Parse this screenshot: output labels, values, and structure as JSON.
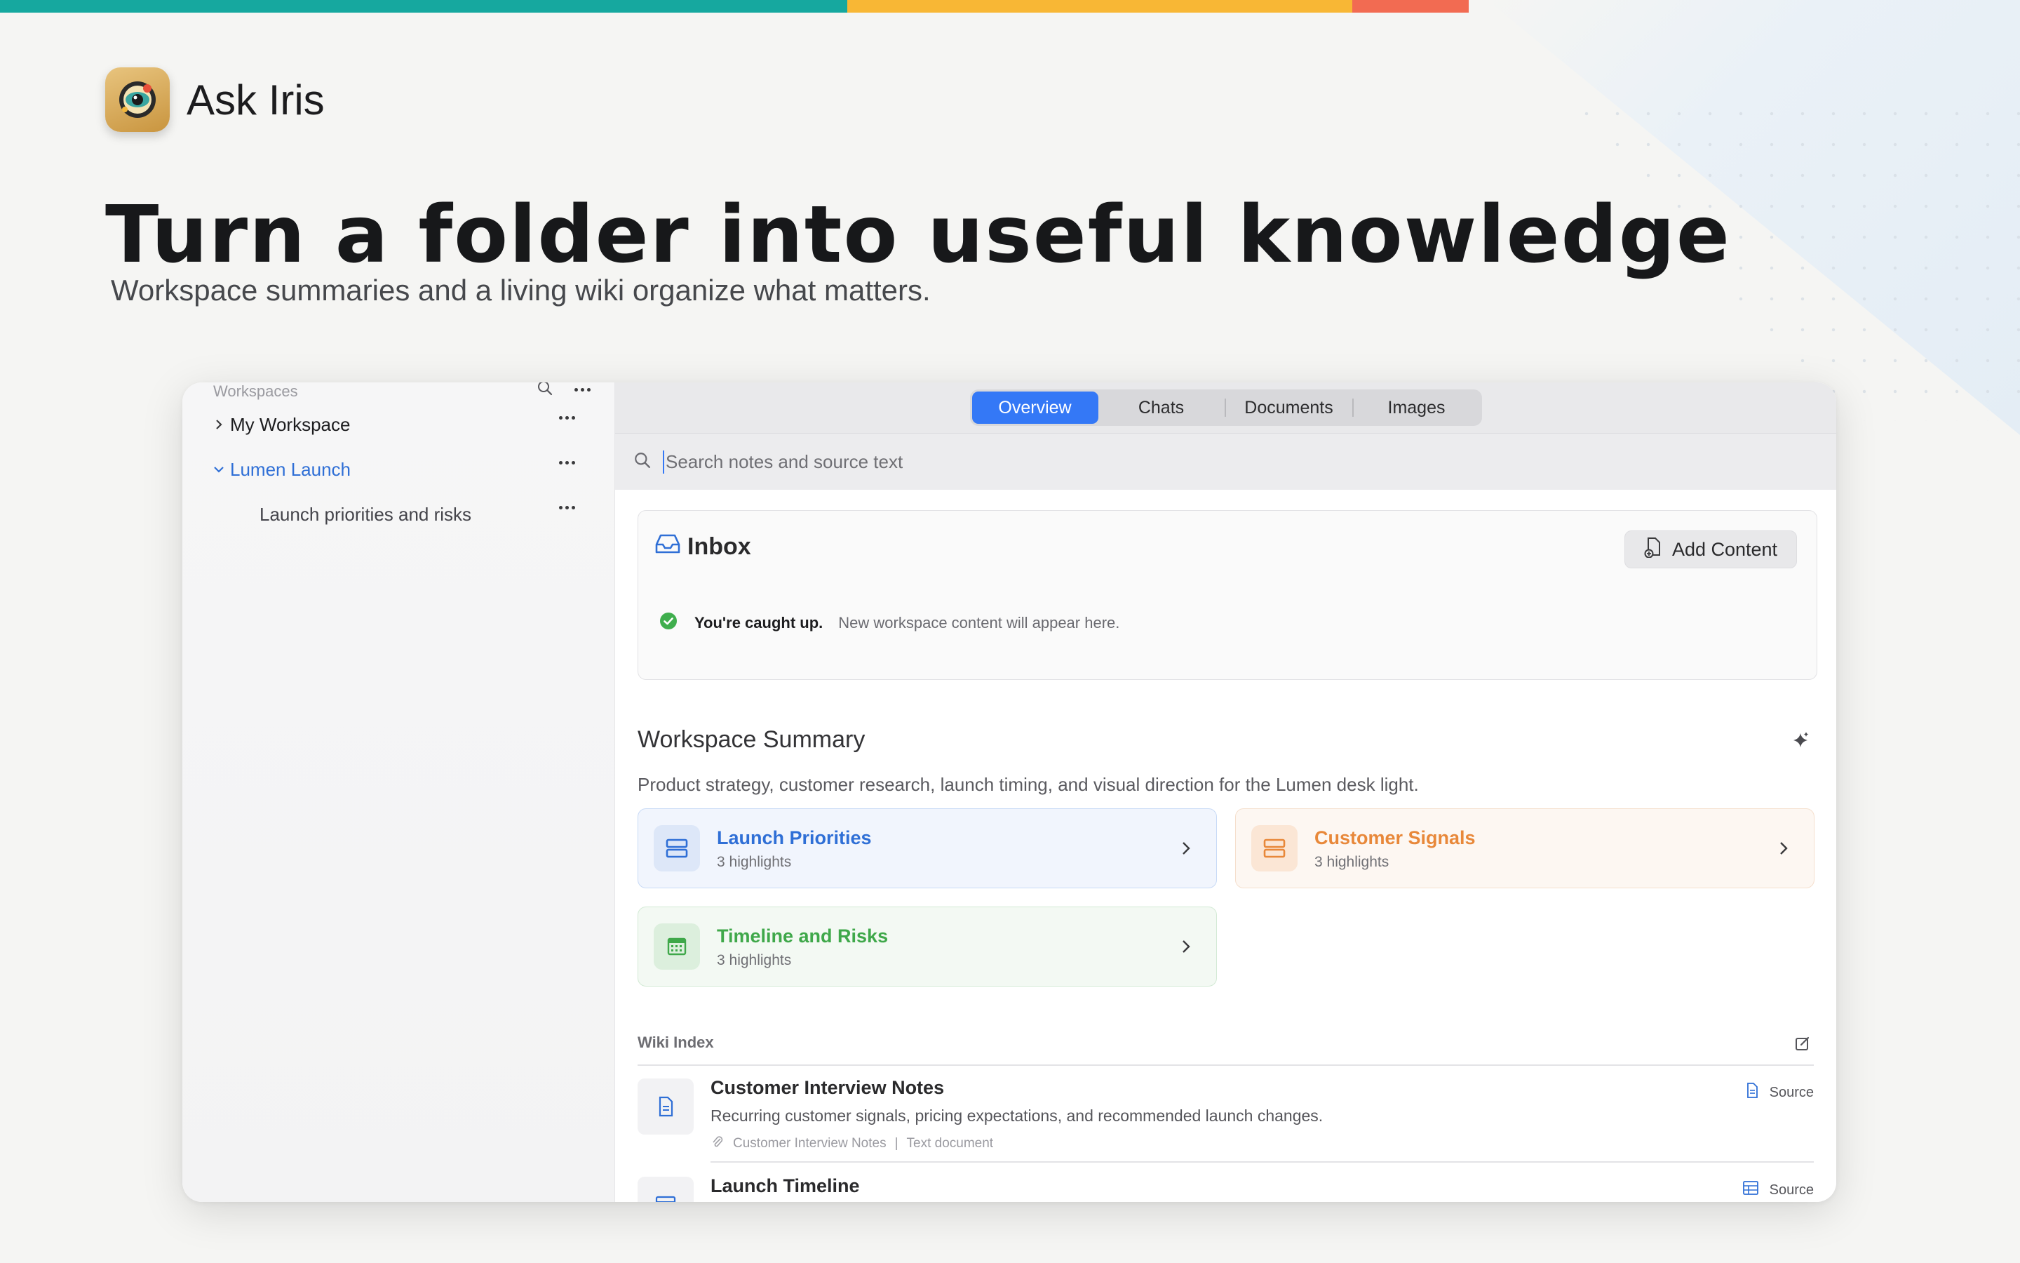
{
  "brand": {
    "app_name": "Ask Iris",
    "headline": "Turn a folder into useful knowledge",
    "subheadline": "Workspace summaries and a living wiki organize what matters.",
    "stripe_colors": [
      "#16a89f",
      "#f8b735",
      "#f26b52"
    ]
  },
  "sidebar": {
    "header": "Workspaces",
    "items": [
      {
        "label": "My Workspace",
        "state": "collapsed"
      },
      {
        "label": "Lumen Launch",
        "state": "expanded",
        "active": true
      },
      {
        "label": "Launch priorities and risks",
        "state": "child"
      }
    ]
  },
  "tabs": [
    {
      "label": "Overview",
      "active": true
    },
    {
      "label": "Chats"
    },
    {
      "label": "Documents"
    },
    {
      "label": "Images"
    }
  ],
  "search": {
    "placeholder": "Search notes and source text"
  },
  "inbox": {
    "title": "Inbox",
    "add_button": "Add Content",
    "status_strong": "You're caught up.",
    "status_text": "New workspace content will appear here."
  },
  "summary": {
    "title": "Workspace Summary",
    "description": "Product strategy, customer research, launch timing, and visual direction for the Lumen desk light.",
    "cards": [
      {
        "title": "Launch Priorities",
        "subtitle": "3 highlights",
        "color": "#2f6fd6",
        "bg": "#f1f5fd",
        "border": "#c8daf6",
        "icon_bg": "#dde7f8",
        "icon": "stack-icon"
      },
      {
        "title": "Customer Signals",
        "subtitle": "3 highlights",
        "color": "#e8883a",
        "bg": "#fdf7f2",
        "border": "#f5dfcd",
        "icon_bg": "#fbe6d5",
        "icon": "stack-icon"
      },
      {
        "title": "Timeline and Risks",
        "subtitle": "3 highlights",
        "color": "#3fa84a",
        "bg": "#f3f9f3",
        "border": "#d3ead5",
        "icon_bg": "#dcefdd",
        "icon": "calendar-icon"
      }
    ]
  },
  "wiki": {
    "label": "Wiki Index",
    "rows": [
      {
        "title": "Customer Interview Notes",
        "description": "Recurring customer signals, pricing expectations, and recommended launch changes.",
        "meta_source": "Customer Interview Notes",
        "meta_sep": "|",
        "meta_type": "Text document",
        "source_label": "Source",
        "icon": "document-icon"
      },
      {
        "title": "Launch Timeline",
        "source_label": "Source",
        "icon": "table-icon"
      }
    ]
  },
  "colors": {
    "accent": "#3478f6",
    "success": "#3fae4d"
  }
}
